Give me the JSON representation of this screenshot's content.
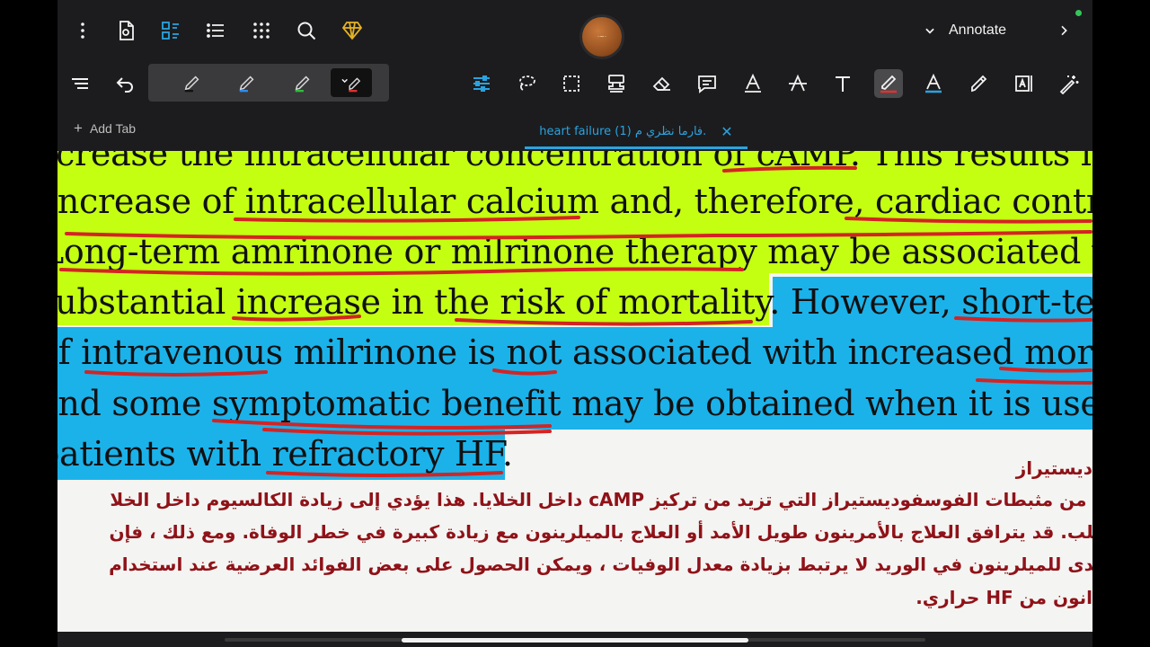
{
  "toolbar": {
    "mode_label": "Annotate"
  },
  "tabs": {
    "add_tab_label": "Add Tab",
    "active_tab_title": "heart failure (1) فارما نظري م.",
    "close_symbol": "✕"
  },
  "avatar": {
    "text": "·~·"
  },
  "colors": {
    "app_background": "#1c1c1e",
    "accent_blue": "#29a3e0",
    "highlight_green": "#c4ff12",
    "highlight_blue": "#1bb2ea",
    "ink_red": "#d32424",
    "arabic_text": "#8f1218",
    "status_green": "#33c759"
  },
  "icons": {
    "top_row": [
      "more-vertical-icon",
      "document-settings-icon",
      "tab-switch-icon",
      "outline-list-icon",
      "grid-icon",
      "search-icon",
      "premium-diamond-icon"
    ],
    "tool_row": [
      "toolbar-hide-icon",
      "undo-icon",
      "pen-black-icon",
      "pen-blue-icon",
      "pen-green-icon",
      "pen-red-icon",
      "settings-sliders-icon",
      "lasso-icon",
      "selection-box-icon",
      "stamp-icon",
      "eraser-icon",
      "comment-icon",
      "text-underline-icon",
      "text-strike-icon",
      "text-box-icon",
      "highlighter-active-icon",
      "text-color-icon",
      "marker-icon",
      "text-edit-icon",
      "magic-wand-icon"
    ]
  },
  "document": {
    "english_lines": [
      "increase the intracellular concentration of cAMP. This results in",
      "increase of intracellular calcium and, therefore, cardiac contrac",
      "Long-term amrinone or milrinone therapy may be associated w",
      "substantial increase in the risk of mortality. However, short-ter",
      "of intravenous milrinone is not associated with increased morta",
      "and some symptomatic benefit may be obtained when it is used",
      "patients with refractory HF."
    ],
    "arabic_title": "ديستيراز",
    "arabic_lines": [
      "ون من مثبطات الفوسفوديستيراز التي تزيد من تركيز cAMP داخل الخلايا.  هذا يؤدي إلى زيادة الكالسيوم داخل الخلا",
      "القلب.  قد يترافق العلاج بالأمرينون طويل الأمد أو العلاج بالميلرينون مع زيادة كبيرة في خطر الوفاة.  ومع ذلك ، فإن",
      "المدى للميلرينون في الوريد لا يرتبط بزيادة معدل الوفيات ، ويمكن الحصول على بعض الفوائد العرضية عند استخدام",
      "انون من HF حراري."
    ]
  }
}
